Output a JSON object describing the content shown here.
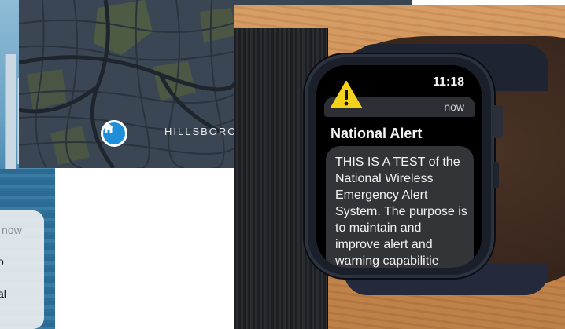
{
  "left_card": {
    "time_label": "now",
    "partial_line_1": "o",
    "partial_line_2": "al"
  },
  "map": {
    "place_label": "HILLSBOROU",
    "pin_icon": "home-icon"
  },
  "watch": {
    "time": "11:18",
    "notification": {
      "received": "now",
      "title": "National Alert",
      "body": "THIS IS A TEST of the National Wireless Emergency Alert System. The purpose is to maintain and improve alert and warning capabilitie"
    }
  },
  "colors": {
    "map_bg": "#3b4654",
    "pin_blue": "#1e8fd8",
    "warning_yellow": "#f2d21b",
    "watch_screen_bg": "#000000"
  }
}
